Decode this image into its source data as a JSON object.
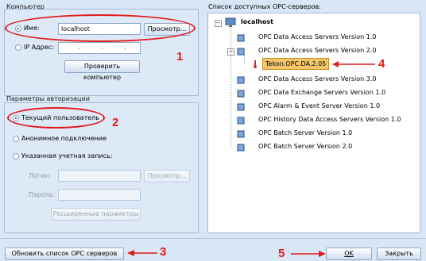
{
  "computer_group": {
    "title": "Компьютер",
    "name_label": "Имя:",
    "name_value": "localhost",
    "browse_button": "Просмотр...",
    "ip_label": "IP Адрес:",
    "ip_value": ". . .",
    "check_button": "Проверить компьютер"
  },
  "auth_group": {
    "title": "Параметры авторизации",
    "current_user": "Текущий пользователь",
    "anonymous": "Анонимное подключение",
    "specified_account": "Указанная учетная запись:",
    "login_label": "Логин:",
    "password_label": "Пароль:",
    "browse_button": "Просмотр...",
    "advanced_button": "Расширенные параметры"
  },
  "server_list": {
    "title": "Список доступных OPC-серверов:",
    "root": "localhost",
    "items": [
      "OPC Data Access Servers Version 1.0",
      "OPC Data Access Servers Version 2.0",
      "Tekon.OPC.DA.2.05",
      "OPC Data Access Servers Version 3.0",
      "OPC Data Exchange Servers Version 1.0",
      "OPC Alarm & Event Server Version 1.0",
      "OPC History Data Access Servers Version 1.0",
      "OPC Batch Server Version 1.0",
      "OPC Batch Server Version 2.0"
    ]
  },
  "bottom": {
    "refresh_button": "Обновить список OPC серверов",
    "ok_button": "OK",
    "close_button": "Закрыть"
  },
  "annotations": [
    "1",
    "2",
    "3",
    "4",
    "5"
  ],
  "colors": {
    "annotation": "#e01b1b",
    "window_bg": "#d9e6f5",
    "selected_item_bg": "#f5c66b"
  }
}
